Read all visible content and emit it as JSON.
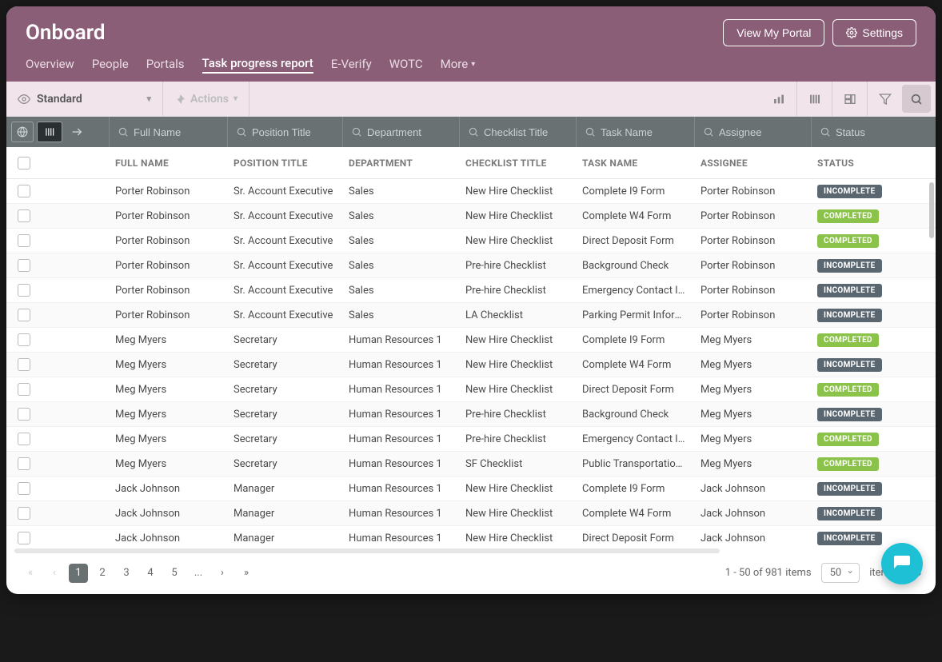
{
  "header": {
    "title": "Onboard",
    "view_portal_label": "View My Portal",
    "settings_label": "Settings"
  },
  "nav": {
    "items": [
      "Overview",
      "People",
      "Portals",
      "Task progress report",
      "E-Verify",
      "WOTC",
      "More"
    ],
    "active_index": 3
  },
  "toolbar": {
    "view_label": "Standard",
    "actions_label": "Actions"
  },
  "filters": {
    "placeholders": {
      "full_name": "Full Name",
      "position_title": "Position Title",
      "department": "Department",
      "checklist_title": "Checklist Title",
      "task_name": "Task Name",
      "assignee": "Assignee",
      "status": "Status"
    }
  },
  "columns": {
    "full_name": "FULL NAME",
    "position_title": "POSITION TITLE",
    "department": "DEPARTMENT",
    "checklist_title": "CHECKLIST TITLE",
    "task_name": "TASK NAME",
    "assignee": "ASSIGNEE",
    "status": "STATUS"
  },
  "status_labels": {
    "incomplete": "INCOMPLETE",
    "completed": "COMPLETED"
  },
  "rows": [
    {
      "full_name": "Porter Robinson",
      "position_title": "Sr. Account Executive",
      "department": "Sales",
      "checklist_title": "New Hire Checklist",
      "task_name": "Complete I9 Form",
      "assignee": "Porter Robinson",
      "status": "incomplete"
    },
    {
      "full_name": "Porter Robinson",
      "position_title": "Sr. Account Executive",
      "department": "Sales",
      "checklist_title": "New Hire Checklist",
      "task_name": "Complete W4 Form",
      "assignee": "Porter Robinson",
      "status": "completed"
    },
    {
      "full_name": "Porter Robinson",
      "position_title": "Sr. Account Executive",
      "department": "Sales",
      "checklist_title": "New Hire Checklist",
      "task_name": "Direct Deposit Form",
      "assignee": "Porter Robinson",
      "status": "completed"
    },
    {
      "full_name": "Porter Robinson",
      "position_title": "Sr. Account Executive",
      "department": "Sales",
      "checklist_title": "Pre-hire Checklist",
      "task_name": "Background Check",
      "assignee": "Porter Robinson",
      "status": "incomplete"
    },
    {
      "full_name": "Porter Robinson",
      "position_title": "Sr. Account Executive",
      "department": "Sales",
      "checklist_title": "Pre-hire Checklist",
      "task_name": "Emergency Contact Inf…",
      "assignee": "Porter Robinson",
      "status": "incomplete"
    },
    {
      "full_name": "Porter Robinson",
      "position_title": "Sr. Account Executive",
      "department": "Sales",
      "checklist_title": "LA Checklist",
      "task_name": "Parking Permit Informa…",
      "assignee": "Porter Robinson",
      "status": "incomplete"
    },
    {
      "full_name": "Meg Myers",
      "position_title": "Secretary",
      "department": "Human Resources 1",
      "checklist_title": "New Hire Checklist",
      "task_name": "Complete I9 Form",
      "assignee": "Meg Myers",
      "status": "completed"
    },
    {
      "full_name": "Meg Myers",
      "position_title": "Secretary",
      "department": "Human Resources 1",
      "checklist_title": "New Hire Checklist",
      "task_name": "Complete W4 Form",
      "assignee": "Meg Myers",
      "status": "incomplete"
    },
    {
      "full_name": "Meg Myers",
      "position_title": "Secretary",
      "department": "Human Resources 1",
      "checklist_title": "New Hire Checklist",
      "task_name": "Direct Deposit Form",
      "assignee": "Meg Myers",
      "status": "completed"
    },
    {
      "full_name": "Meg Myers",
      "position_title": "Secretary",
      "department": "Human Resources 1",
      "checklist_title": "Pre-hire Checklist",
      "task_name": "Background Check",
      "assignee": "Meg Myers",
      "status": "incomplete"
    },
    {
      "full_name": "Meg Myers",
      "position_title": "Secretary",
      "department": "Human Resources 1",
      "checklist_title": "Pre-hire Checklist",
      "task_name": "Emergency Contact Inf…",
      "assignee": "Meg Myers",
      "status": "completed"
    },
    {
      "full_name": "Meg Myers",
      "position_title": "Secretary",
      "department": "Human Resources 1",
      "checklist_title": "SF Checklist",
      "task_name": "Public Transportation F…",
      "assignee": "Meg Myers",
      "status": "completed"
    },
    {
      "full_name": "Jack Johnson",
      "position_title": "Manager",
      "department": "Human Resources 1",
      "checklist_title": "New Hire Checklist",
      "task_name": "Complete I9 Form",
      "assignee": "Jack Johnson",
      "status": "incomplete"
    },
    {
      "full_name": "Jack Johnson",
      "position_title": "Manager",
      "department": "Human Resources 1",
      "checklist_title": "New Hire Checklist",
      "task_name": "Complete W4 Form",
      "assignee": "Jack Johnson",
      "status": "incomplete"
    },
    {
      "full_name": "Jack Johnson",
      "position_title": "Manager",
      "department": "Human Resources 1",
      "checklist_title": "New Hire Checklist",
      "task_name": "Direct Deposit Form",
      "assignee": "Jack Johnson",
      "status": "incomplete"
    }
  ],
  "footer": {
    "pages": [
      "1",
      "2",
      "3",
      "4",
      "5",
      "..."
    ],
    "active_page_index": 0,
    "range_text": "1 - 50 of 981 items",
    "perpage_value": "50",
    "perpage_suffix": "items per p"
  }
}
